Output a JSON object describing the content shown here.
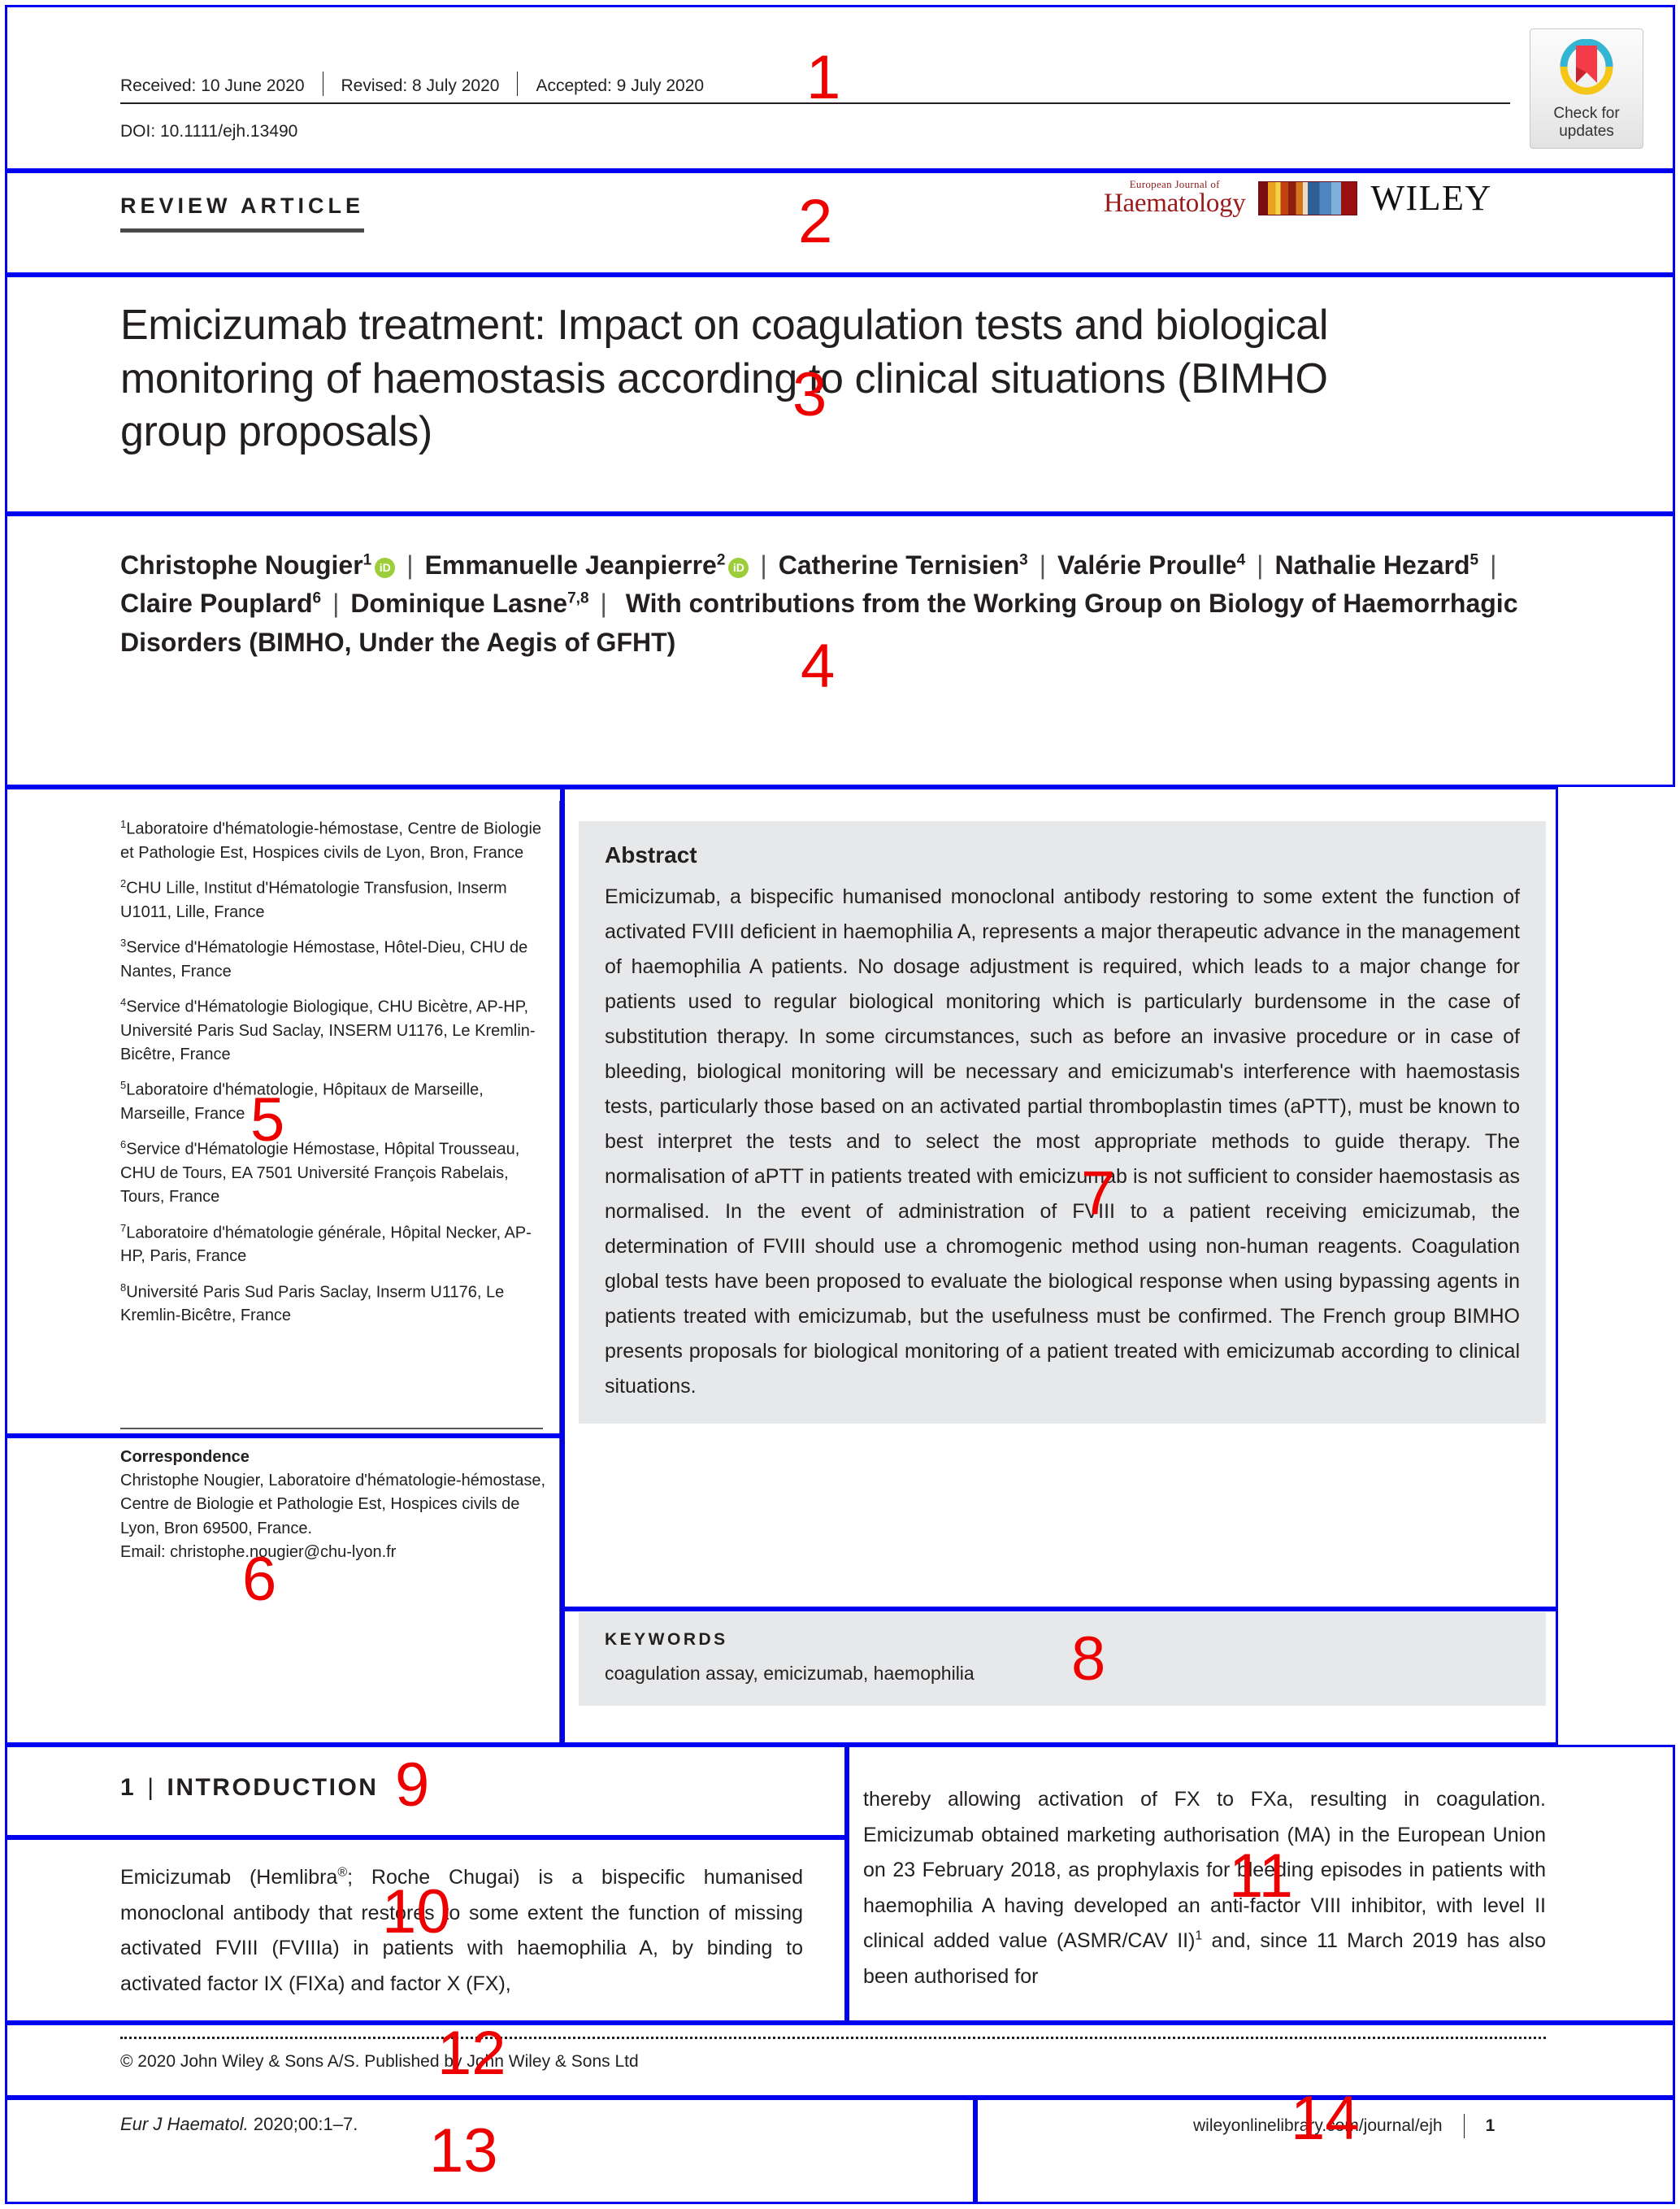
{
  "header": {
    "received": "Received: 10 June 2020",
    "revised": "Revised: 8 July 2020",
    "accepted": "Accepted: 9 July 2020",
    "doi": "DOI: 10.1111/ejh.13490",
    "check_updates_line1": "Check for",
    "check_updates_line2": "updates"
  },
  "branding": {
    "journal_small": "European Journal of",
    "journal_name": "Haematology",
    "publisher": "WILEY"
  },
  "article": {
    "kicker": "REVIEW ARTICLE",
    "title": "Emicizumab treatment: Impact on coagulation tests and biological monitoring of haemostasis according to clinical situations (BIMHO group proposals)"
  },
  "authors": {
    "list": [
      {
        "name": "Christophe Nougier",
        "sup": "1",
        "orcid": true
      },
      {
        "name": "Emmanuelle Jeanpierre",
        "sup": "2",
        "orcid": true
      },
      {
        "name": "Catherine Ternisien",
        "sup": "3",
        "orcid": false
      },
      {
        "name": "Valérie Proulle",
        "sup": "4",
        "orcid": false
      },
      {
        "name": "Nathalie Hezard",
        "sup": "5",
        "orcid": false
      },
      {
        "name": "Claire Pouplard",
        "sup": "6",
        "orcid": false
      },
      {
        "name": "Dominique Lasne",
        "sup": "7,8",
        "orcid": false
      }
    ],
    "group_line": "With contributions from the Working Group on Biology of Haemorrhagic Disorders (BIMHO, Under the Aegis of GFHT)",
    "orcid_label": "iD"
  },
  "affiliations": [
    {
      "sup": "1",
      "text": "Laboratoire d'hématologie-hémostase, Centre de Biologie et Pathologie Est, Hospices civils de Lyon, Bron, France"
    },
    {
      "sup": "2",
      "text": "CHU Lille, Institut d'Hématologie Transfusion, Inserm U1011, Lille, France"
    },
    {
      "sup": "3",
      "text": "Service d'Hématologie Hémostase, Hôtel-Dieu, CHU de Nantes, France"
    },
    {
      "sup": "4",
      "text": "Service d'Hématologie Biologique, CHU Bicètre, AP-HP, Université Paris Sud Saclay, INSERM U1176, Le Kremlin-Bicêtre, France"
    },
    {
      "sup": "5",
      "text": "Laboratoire d'hématologie, Hôpitaux de Marseille, Marseille, France"
    },
    {
      "sup": "6",
      "text": "Service d'Hématologie Hémostase, Hôpital Trousseau, CHU de Tours, EA 7501 Université François Rabelais, Tours, France"
    },
    {
      "sup": "7",
      "text": "Laboratoire d'hématologie générale, Hôpital Necker, AP-HP, Paris, France"
    },
    {
      "sup": "8",
      "text": "Université Paris Sud Paris Saclay, Inserm U1176, Le Kremlin-Bicêtre, France"
    }
  ],
  "correspondence": {
    "title": "Correspondence",
    "body": "Christophe Nougier, Laboratoire d'hématologie-hémostase, Centre de Biologie et Pathologie Est, Hospices civils de Lyon, Bron 69500, France.",
    "email": "Email: christophe.nougier@chu-lyon.fr"
  },
  "abstract": {
    "title": "Abstract",
    "body": "Emicizumab, a bispecific humanised monoclonal antibody restoring to some extent the function of activated FVIII deficient in haemophilia A, represents a major therapeutic advance in the management of haemophilia A patients. No dosage adjustment is required, which leads to a major change for patients used to regular biological monitoring which is particularly burdensome in the case of substitution therapy. In some circumstances, such as before an invasive procedure or in case of bleeding, biological monitoring will be necessary and emicizumab's interference with haemostasis tests, particularly those based on an activated partial thromboplastin times (aPTT), must be known to best interpret the tests and to select the most appropriate methods to guide therapy. The normalisation of aPTT in patients treated with emicizumab is not sufficient to consider haemostasis as normalised. In the event of administration of FVIII to a patient receiving emicizumab, the determination of FVIII should use a chromogenic method using non-human reagents. Coagulation global tests have been proposed to evaluate the biological response when using bypassing agents in patients treated with emicizumab, but the usefulness must be confirmed. The French group BIMHO presents proposals for biological monitoring of a patient treated with emicizumab according to clinical situations."
  },
  "keywords": {
    "title": "KEYWORDS",
    "body": "coagulation assay, emicizumab, haemophilia"
  },
  "introduction": {
    "number": "1",
    "bar": "|",
    "heading": "INTRODUCTION",
    "left_pre": "Emicizumab (Hemlibra",
    "left_sup": "®",
    "left_post": "; Roche Chugai) is a bispecific humanised monoclonal antibody that restores to some extent the function of missing activated FVIII (FVIIIa) in patients with haemophilia A, by binding to activated factor IX (FIXa) and factor X (FX),",
    "right_pre": "thereby allowing activation of FX to FXa, resulting in coagulation. Emicizumab obtained marketing authorisation (MA) in the European Union on 23 February 2018, as prophylaxis for bleeding episodes in patients with haemophilia A having developed an anti-factor VIII inhibitor, with level II clinical added value (ASMR/CAV II)",
    "right_sup": "1",
    "right_post": " and, since 11 March 2019 has also been authorised for"
  },
  "footer": {
    "copyright": "© 2020 John Wiley & Sons A/S. Published by John Wiley & Sons Ltd",
    "citation_italic": "Eur J Haematol.",
    "citation_rest": " 2020;00:1–7.",
    "url": "wileyonlinelibrary.com/journal/ejh",
    "page": "1"
  },
  "annotations": {
    "numbers": [
      "1",
      "2",
      "3",
      "4",
      "5",
      "6",
      "7",
      "8",
      "9",
      "10",
      "11",
      "12",
      "13",
      "14"
    ],
    "box_color": "#0000ee",
    "number_color": "#ee0000"
  }
}
